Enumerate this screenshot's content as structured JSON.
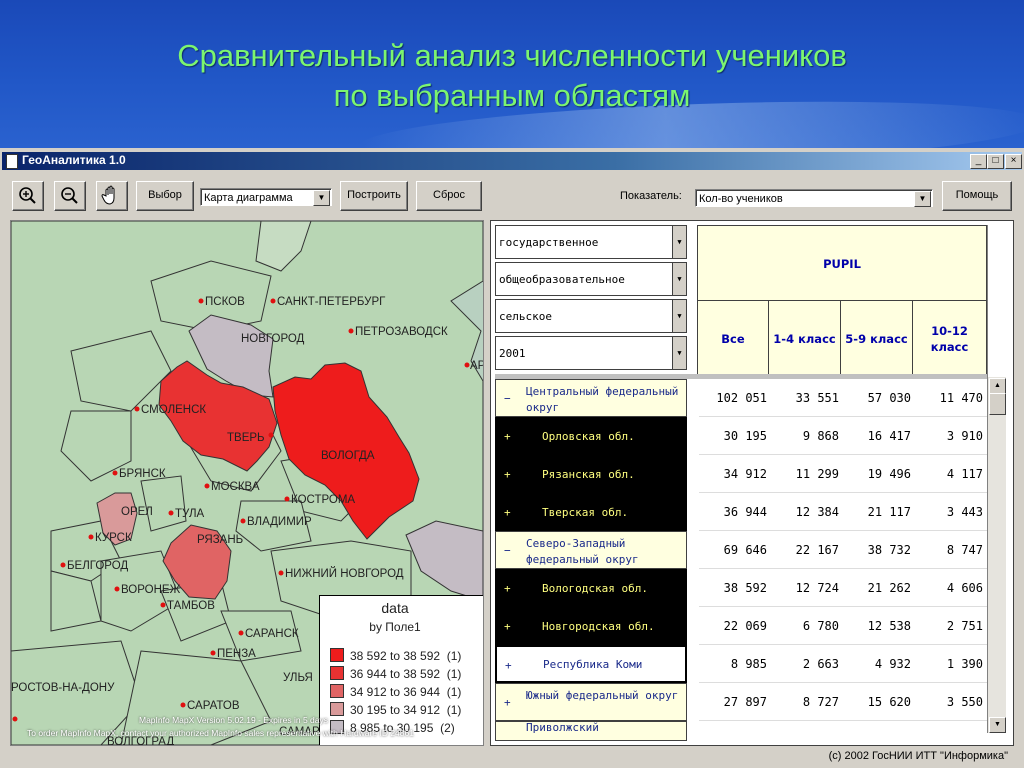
{
  "slide": {
    "title_line1": "Сравнительный анализ численности учеников",
    "title_line2": "по выбранным областям",
    "accent_color": "#7cf56f"
  },
  "window": {
    "title": "ГеоАналитика 1.0",
    "min_label": "_",
    "max_label": "□",
    "close_label": "×"
  },
  "toolbar": {
    "zoom_in_icon": "zoom-in-icon",
    "zoom_out_icon": "zoom-out-icon",
    "pan_icon": "pan-hand-icon",
    "select_label": "Выбор",
    "map_type_value": "Карта диаграмма",
    "build_label": "Построить",
    "reset_label": "Сброс",
    "indicator_label": "Показатель:",
    "indicator_value": "Кол-во учеников",
    "help_label": "Помощь",
    "dropdown_arrow": "▼"
  },
  "map": {
    "cities": {
      "pskov": "ПСКОВ",
      "spb": "САНКТ-ПЕТЕРБУРГ",
      "novgorod": "НОВГОРОД",
      "petrozavodsk": "ПЕТРОЗАВОДСК",
      "smolensk": "СМОЛЕНСК",
      "tver": "ТВЕРЬ",
      "vologda": "ВОЛОГДА",
      "bryansk": "БРЯНСК",
      "moscow": "МОСКВА",
      "kostroma": "КОСТРОМА",
      "orel": "ОРЕЛ",
      "tula": "ТУЛА",
      "vladimir": "ВЛАДИМИР",
      "kursk": "КУРСК",
      "ryazan": "РЯЗАНЬ",
      "belgorod": "БЕЛГОРОД",
      "nizhny": "НИЖНИЙ НОВГОРОД",
      "voronezh": "ВОРОНЕЖ",
      "tambov": "ТАМБОВ",
      "saransk": "САРАНСК",
      "penza": "ПЕНЗА",
      "rostov": "РОСТОВ-НА-ДОНУ",
      "saratov": "САРАТОВ",
      "ulyanovsk": "УЛЬЯ",
      "samara": "САМАРІ",
      "volgograd": "ВОЛГОГРАД",
      "arkh": "АР"
    },
    "legend": {
      "title": "data",
      "subtitle": "by Поле1",
      "items": [
        {
          "range": "38 592 to 38 592",
          "count": "(1)",
          "color": "#ee1c1c"
        },
        {
          "range": "36 944 to 38 592",
          "count": "(1)",
          "color": "#e83232"
        },
        {
          "range": "34 912 to 36 944",
          "count": "(1)",
          "color": "#e06464"
        },
        {
          "range": "30 195 to 34 912",
          "count": "(1)",
          "color": "#d99a9a"
        },
        {
          "range": "8 985 to 30 195",
          "count": "(2)",
          "color": "#c4bcc4"
        }
      ]
    },
    "notice_line1": "MapInfo MapX Version 5.02.19 - Expires in 5 days",
    "notice_line2": "To order MapInfo MapX, contact your authorized MapInfo sales representative with Hardware ID 24861"
  },
  "table": {
    "filters": [
      "государственное",
      "общеобразовательное",
      "сельское",
      "2001"
    ],
    "header_main": "PUPIL",
    "columns": [
      "Все",
      "1-4 класс",
      "5-9 класс",
      "10-12 класс"
    ],
    "rows": [
      {
        "type": "group",
        "sign": "−",
        "name": "Центральный федеральный округ",
        "values": [
          "102 051",
          "33 551",
          "57 030",
          "11 470"
        ]
      },
      {
        "type": "sub",
        "sign": "+",
        "name": "Орловская обл.",
        "values": [
          "30 195",
          "9 868",
          "16 417",
          "3 910"
        ]
      },
      {
        "type": "sub",
        "sign": "+",
        "name": "Рязанская обл.",
        "values": [
          "34 912",
          "11 299",
          "19 496",
          "4 117"
        ]
      },
      {
        "type": "sub",
        "sign": "+",
        "name": "Тверская обл.",
        "values": [
          "36 944",
          "12 384",
          "21 117",
          "3 443"
        ]
      },
      {
        "type": "group",
        "sign": "−",
        "name": "Северо-Западный федеральный округ",
        "values": [
          "69 646",
          "22 167",
          "38 732",
          "8 747"
        ]
      },
      {
        "type": "sub",
        "sign": "+",
        "name": "Вологодская обл.",
        "values": [
          "38 592",
          "12 724",
          "21 262",
          "4 606"
        ]
      },
      {
        "type": "sub",
        "sign": "+",
        "name": "Новгородская обл.",
        "values": [
          "22 069",
          "6 780",
          "12 538",
          "2 751"
        ]
      },
      {
        "type": "subsel",
        "sign": "+",
        "name": "Республика Коми",
        "values": [
          "8 985",
          "2 663",
          "4 932",
          "1 390"
        ]
      },
      {
        "type": "group",
        "sign": "+",
        "name": "Южный федеральный округ",
        "values": [
          "27 897",
          "8 727",
          "15 620",
          "3 550"
        ]
      }
    ],
    "partial_row": "Приволжский"
  },
  "footer": {
    "copyright": "(c) 2002 ГосНИИ ИТТ \"Информика\""
  }
}
